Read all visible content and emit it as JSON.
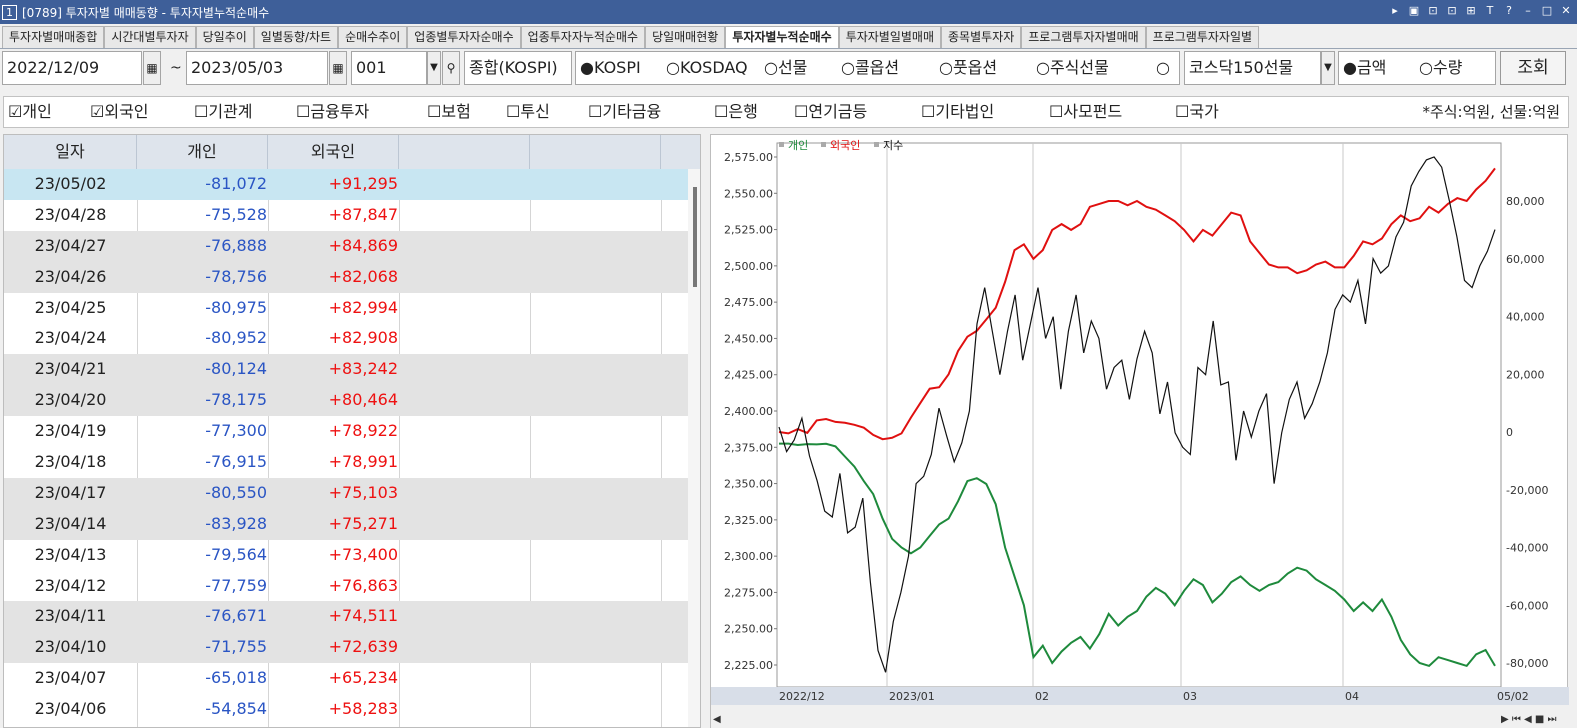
{
  "window": {
    "number": "1",
    "title": "[0789] 투자자별 매매동향 - 투자자별누적순매수",
    "controls": [
      "▸",
      "▣",
      "⊡",
      "⊡",
      "⊞",
      "T",
      "?",
      "–",
      "□",
      "✕"
    ]
  },
  "tabs": [
    {
      "label": "투자자별매매종합"
    },
    {
      "label": "시간대별투자자"
    },
    {
      "label": "당일추이"
    },
    {
      "label": "일별동향/차트"
    },
    {
      "label": "순매수추이"
    },
    {
      "label": "업종별투자자순매수"
    },
    {
      "label": "업종투자자누적순매수"
    },
    {
      "label": "당일매매현황"
    },
    {
      "label": "투자자별누적순매수",
      "active": true
    },
    {
      "label": "투자자별일별매매"
    },
    {
      "label": "종목별투자자"
    },
    {
      "label": "프로그램투자자별매매"
    },
    {
      "label": "프로그램투자자일별"
    }
  ],
  "toolbar": {
    "start_date": "2022/12/09",
    "tilde": "~",
    "end_date": "2023/05/03",
    "code": "001",
    "market_label": "종합(KOSPI)",
    "market_radios": [
      {
        "label": "●KOSPI",
        "checked": true
      },
      {
        "label": "○KOSDAQ",
        "checked": false
      },
      {
        "label": "○선물",
        "checked": false
      },
      {
        "label": "○콜옵션",
        "checked": false
      },
      {
        "label": "○풋옵션",
        "checked": false
      },
      {
        "label": "○주식선물",
        "checked": false
      },
      {
        "label": "○",
        "checked": false
      }
    ],
    "kosdaq150_select": "코스닥150선물",
    "value_radios": [
      {
        "label": "●금액",
        "checked": true
      },
      {
        "label": "○수량",
        "checked": false
      }
    ],
    "search_button": "조회"
  },
  "investor_checks": [
    {
      "label": "☑개인",
      "checked": true
    },
    {
      "label": "☑외국인",
      "checked": true
    },
    {
      "label": "☐기관계",
      "checked": false
    },
    {
      "label": "☐금융투자",
      "checked": false
    },
    {
      "label": "☐보험",
      "checked": false
    },
    {
      "label": "☐투신",
      "checked": false
    },
    {
      "label": "☐기타금융",
      "checked": false
    },
    {
      "label": "☐은행",
      "checked": false
    },
    {
      "label": "☐연기금등",
      "checked": false
    },
    {
      "label": "☐기타법인",
      "checked": false
    },
    {
      "label": "☐사모펀드",
      "checked": false
    },
    {
      "label": "☐국가",
      "checked": false
    }
  ],
  "unit_note": "*주식:억원, 선물:억원",
  "table": {
    "headers": [
      "일자",
      "개인",
      "외국인"
    ],
    "rows": [
      {
        "date": "23/05/02",
        "individual": "-81,072",
        "foreign": "+91,295"
      },
      {
        "date": "23/04/28",
        "individual": "-75,528",
        "foreign": "+87,847"
      },
      {
        "date": "23/04/27",
        "individual": "-76,888",
        "foreign": "+84,869"
      },
      {
        "date": "23/04/26",
        "individual": "-78,756",
        "foreign": "+82,068"
      },
      {
        "date": "23/04/25",
        "individual": "-80,975",
        "foreign": "+82,994"
      },
      {
        "date": "23/04/24",
        "individual": "-80,952",
        "foreign": "+82,908"
      },
      {
        "date": "23/04/21",
        "individual": "-80,124",
        "foreign": "+83,242"
      },
      {
        "date": "23/04/20",
        "individual": "-78,175",
        "foreign": "+80,464"
      },
      {
        "date": "23/04/19",
        "individual": "-77,300",
        "foreign": "+78,922"
      },
      {
        "date": "23/04/18",
        "individual": "-76,915",
        "foreign": "+78,991"
      },
      {
        "date": "23/04/17",
        "individual": "-80,550",
        "foreign": "+75,103"
      },
      {
        "date": "23/04/14",
        "individual": "-83,928",
        "foreign": "+75,271"
      },
      {
        "date": "23/04/13",
        "individual": "-79,564",
        "foreign": "+73,400"
      },
      {
        "date": "23/04/12",
        "individual": "-77,759",
        "foreign": "+76,863"
      },
      {
        "date": "23/04/11",
        "individual": "-76,671",
        "foreign": "+74,511"
      },
      {
        "date": "23/04/10",
        "individual": "-71,755",
        "foreign": "+72,639"
      },
      {
        "date": "23/04/07",
        "individual": "-65,018",
        "foreign": "+65,234"
      },
      {
        "date": "23/04/06",
        "individual": "-54,854",
        "foreign": "+58,283"
      }
    ]
  },
  "colors": {
    "individual": "#1e8a3c",
    "foreign": "#e01010",
    "index": "#111111",
    "blue_text": "#2a55c4",
    "red_text": "#e11111"
  },
  "chart_data": {
    "type": "line",
    "legend": [
      {
        "name": "개인",
        "color": "#1e8a3c"
      },
      {
        "name": "외국인",
        "color": "#e01010"
      },
      {
        "name": "지수",
        "color": "#111111"
      }
    ],
    "legend_placement": "top-left",
    "left_axis": {
      "ticks": [
        "2,575.00",
        "2,550.00",
        "2,525.00",
        "2,500.00",
        "2,475.00",
        "2,450.00",
        "2,425.00",
        "2,400.00",
        "2,375.00",
        "2,350.00",
        "2,325.00",
        "2,300.00",
        "2,275.00",
        "2,250.00",
        "2,225.00"
      ],
      "range": [
        2225,
        2575
      ]
    },
    "right_axis": {
      "ticks": [
        "80,000",
        "60,000",
        "40,000",
        "20,000",
        "0",
        "-20,000",
        "-40,000",
        "-60,000",
        "-80,000"
      ],
      "range": [
        -80000,
        80000
      ]
    },
    "x_labels": [
      "2022/12",
      "2023/01",
      "02",
      "03",
      "04",
      "05/02"
    ],
    "grid": true,
    "series": [
      {
        "name": "외국인",
        "axis": "right",
        "values": [
          0,
          -500,
          1000,
          -300,
          4000,
          4500,
          3500,
          3200,
          2500,
          1500,
          -1000,
          -2500,
          -2000,
          -500,
          5000,
          10000,
          15000,
          15500,
          20000,
          28000,
          33000,
          35000,
          39000,
          43000,
          52000,
          63000,
          65000,
          60000,
          63000,
          70000,
          72000,
          70000,
          72000,
          78000,
          79000,
          80000,
          80000,
          78500,
          80000,
          78000,
          77000,
          75000,
          73000,
          70000,
          66000,
          70000,
          68000,
          72000,
          76000,
          75000,
          66000,
          62000,
          58000,
          57000,
          57000,
          55000,
          56000,
          58000,
          59000,
          57000,
          57000,
          61000,
          66000,
          65000,
          67000,
          72000,
          75000,
          73000,
          74000,
          78000,
          76000,
          79000,
          81000,
          80000,
          84000,
          87000,
          91300
        ]
      },
      {
        "name": "개인",
        "axis": "right",
        "values": [
          -4000,
          -4000,
          -4500,
          -4200,
          -4300,
          -4100,
          -5000,
          -8500,
          -12000,
          -17000,
          -21500,
          -30000,
          -37000,
          -40000,
          -42000,
          -40000,
          -36000,
          -32000,
          -30000,
          -24000,
          -17000,
          -16000,
          -18000,
          -25000,
          -40000,
          -50000,
          -60000,
          -78000,
          -74000,
          -80000,
          -76000,
          -73000,
          -71000,
          -75000,
          -70000,
          -63000,
          -67000,
          -64000,
          -62000,
          -57000,
          -54000,
          -56000,
          -60000,
          -55000,
          -51000,
          -53000,
          -59000,
          -56000,
          -52000,
          -50000,
          -53000,
          -55000,
          -53000,
          -52000,
          -49000,
          -47000,
          -48000,
          -51000,
          -53000,
          -55000,
          -58000,
          -62000,
          -59000,
          -62000,
          -58000,
          -64000,
          -72000,
          -77000,
          -80000,
          -81000,
          -78000,
          -79000,
          -80000,
          -81000,
          -77000,
          -75500,
          -81000
        ]
      },
      {
        "name": "지수",
        "axis": "left",
        "values": [
          2389,
          2372,
          2380,
          2395,
          2369,
          2352,
          2331,
          2327,
          2357,
          2316,
          2320,
          2340,
          2282,
          2235,
          2220,
          2255,
          2275,
          2300,
          2350,
          2355,
          2370,
          2402,
          2383,
          2365,
          2378,
          2400,
          2460,
          2485,
          2455,
          2425,
          2455,
          2480,
          2435,
          2460,
          2485,
          2450,
          2465,
          2415,
          2455,
          2480,
          2440,
          2462,
          2450,
          2415,
          2430,
          2435,
          2408,
          2436,
          2455,
          2440,
          2398,
          2420,
          2385,
          2375,
          2370,
          2430,
          2425,
          2462,
          2418,
          2420,
          2366,
          2400,
          2382,
          2400,
          2412,
          2350,
          2385,
          2408,
          2420,
          2395,
          2405,
          2420,
          2440,
          2470,
          2480,
          2475,
          2490,
          2460,
          2505,
          2495,
          2500,
          2520,
          2530,
          2555,
          2565,
          2573,
          2575,
          2568,
          2545,
          2520,
          2490,
          2485,
          2500,
          2510,
          2525
        ]
      }
    ]
  }
}
